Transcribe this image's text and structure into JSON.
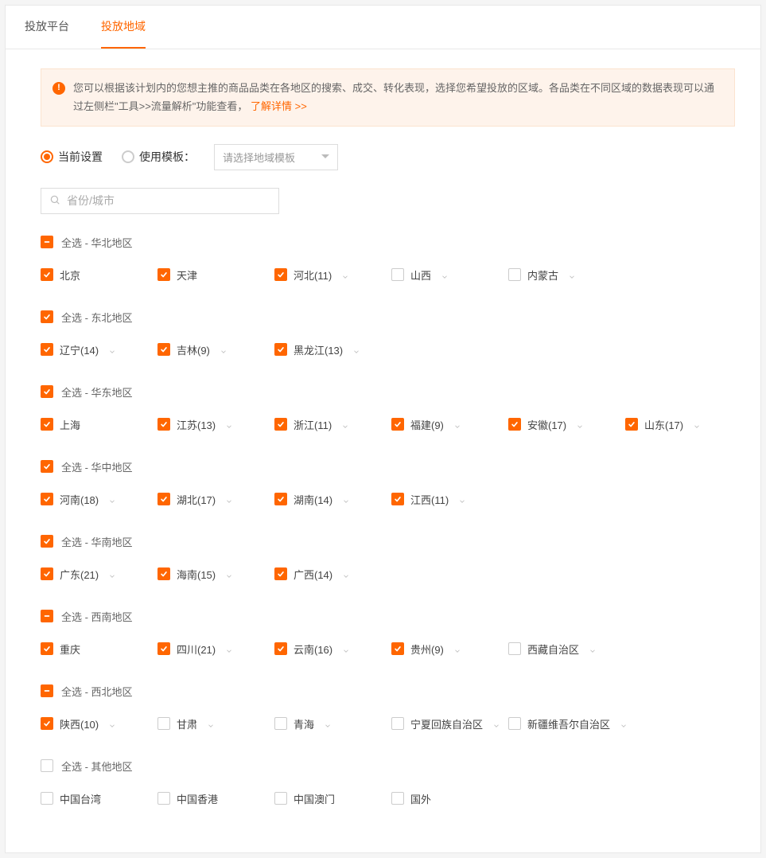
{
  "tabs": {
    "platform": "投放平台",
    "region": "投放地域"
  },
  "notice": {
    "text": "您可以根据该计划内的您想主推的商品品类在各地区的搜索、成交、转化表现，选择您希望投放的区域。各品类在不同区域的数据表现可以通过左侧栏\"工具>>流量解析\"功能查看，",
    "link": "了解详情 >>"
  },
  "settings": {
    "current": "当前设置",
    "template": "使用模板：",
    "select_placeholder": "请选择地域模板"
  },
  "search": {
    "placeholder": "省份/城市"
  },
  "groups": [
    {
      "title": "全选 - 华北地区",
      "state": "indeterminate",
      "items": [
        {
          "label": "北京",
          "checked": true,
          "expandable": false
        },
        {
          "label": "天津",
          "checked": true,
          "expandable": false
        },
        {
          "label": "河北(11)",
          "checked": true,
          "expandable": true
        },
        {
          "label": "山西",
          "checked": false,
          "expandable": true
        },
        {
          "label": "内蒙古",
          "checked": false,
          "expandable": true
        }
      ]
    },
    {
      "title": "全选 - 东北地区",
      "state": "checked",
      "items": [
        {
          "label": "辽宁(14)",
          "checked": true,
          "expandable": true
        },
        {
          "label": "吉林(9)",
          "checked": true,
          "expandable": true
        },
        {
          "label": "黑龙江(13)",
          "checked": true,
          "expandable": true
        }
      ]
    },
    {
      "title": "全选 - 华东地区",
      "state": "checked",
      "items": [
        {
          "label": "上海",
          "checked": true,
          "expandable": false
        },
        {
          "label": "江苏(13)",
          "checked": true,
          "expandable": true
        },
        {
          "label": "浙江(11)",
          "checked": true,
          "expandable": true
        },
        {
          "label": "福建(9)",
          "checked": true,
          "expandable": true
        },
        {
          "label": "安徽(17)",
          "checked": true,
          "expandable": true
        },
        {
          "label": "山东(17)",
          "checked": true,
          "expandable": true
        }
      ]
    },
    {
      "title": "全选 - 华中地区",
      "state": "checked",
      "items": [
        {
          "label": "河南(18)",
          "checked": true,
          "expandable": true
        },
        {
          "label": "湖北(17)",
          "checked": true,
          "expandable": true
        },
        {
          "label": "湖南(14)",
          "checked": true,
          "expandable": true
        },
        {
          "label": "江西(11)",
          "checked": true,
          "expandable": true
        }
      ]
    },
    {
      "title": "全选 - 华南地区",
      "state": "checked",
      "items": [
        {
          "label": "广东(21)",
          "checked": true,
          "expandable": true
        },
        {
          "label": "海南(15)",
          "checked": true,
          "expandable": true
        },
        {
          "label": "广西(14)",
          "checked": true,
          "expandable": true
        }
      ]
    },
    {
      "title": "全选 - 西南地区",
      "state": "indeterminate",
      "items": [
        {
          "label": "重庆",
          "checked": true,
          "expandable": false
        },
        {
          "label": "四川(21)",
          "checked": true,
          "expandable": true
        },
        {
          "label": "云南(16)",
          "checked": true,
          "expandable": true
        },
        {
          "label": "贵州(9)",
          "checked": true,
          "expandable": true
        },
        {
          "label": "西藏自治区",
          "checked": false,
          "expandable": true
        }
      ]
    },
    {
      "title": "全选 - 西北地区",
      "state": "indeterminate",
      "items": [
        {
          "label": "陕西(10)",
          "checked": true,
          "expandable": true
        },
        {
          "label": "甘肃",
          "checked": false,
          "expandable": true
        },
        {
          "label": "青海",
          "checked": false,
          "expandable": true
        },
        {
          "label": "宁夏回族自治区",
          "checked": false,
          "expandable": true
        },
        {
          "label": "新疆维吾尔自治区",
          "checked": false,
          "expandable": true
        }
      ]
    },
    {
      "title": "全选 - 其他地区",
      "state": "unchecked",
      "items": [
        {
          "label": "中国台湾",
          "checked": false,
          "expandable": false
        },
        {
          "label": "中国香港",
          "checked": false,
          "expandable": false
        },
        {
          "label": "中国澳门",
          "checked": false,
          "expandable": false
        },
        {
          "label": "国外",
          "checked": false,
          "expandable": false
        }
      ]
    }
  ]
}
